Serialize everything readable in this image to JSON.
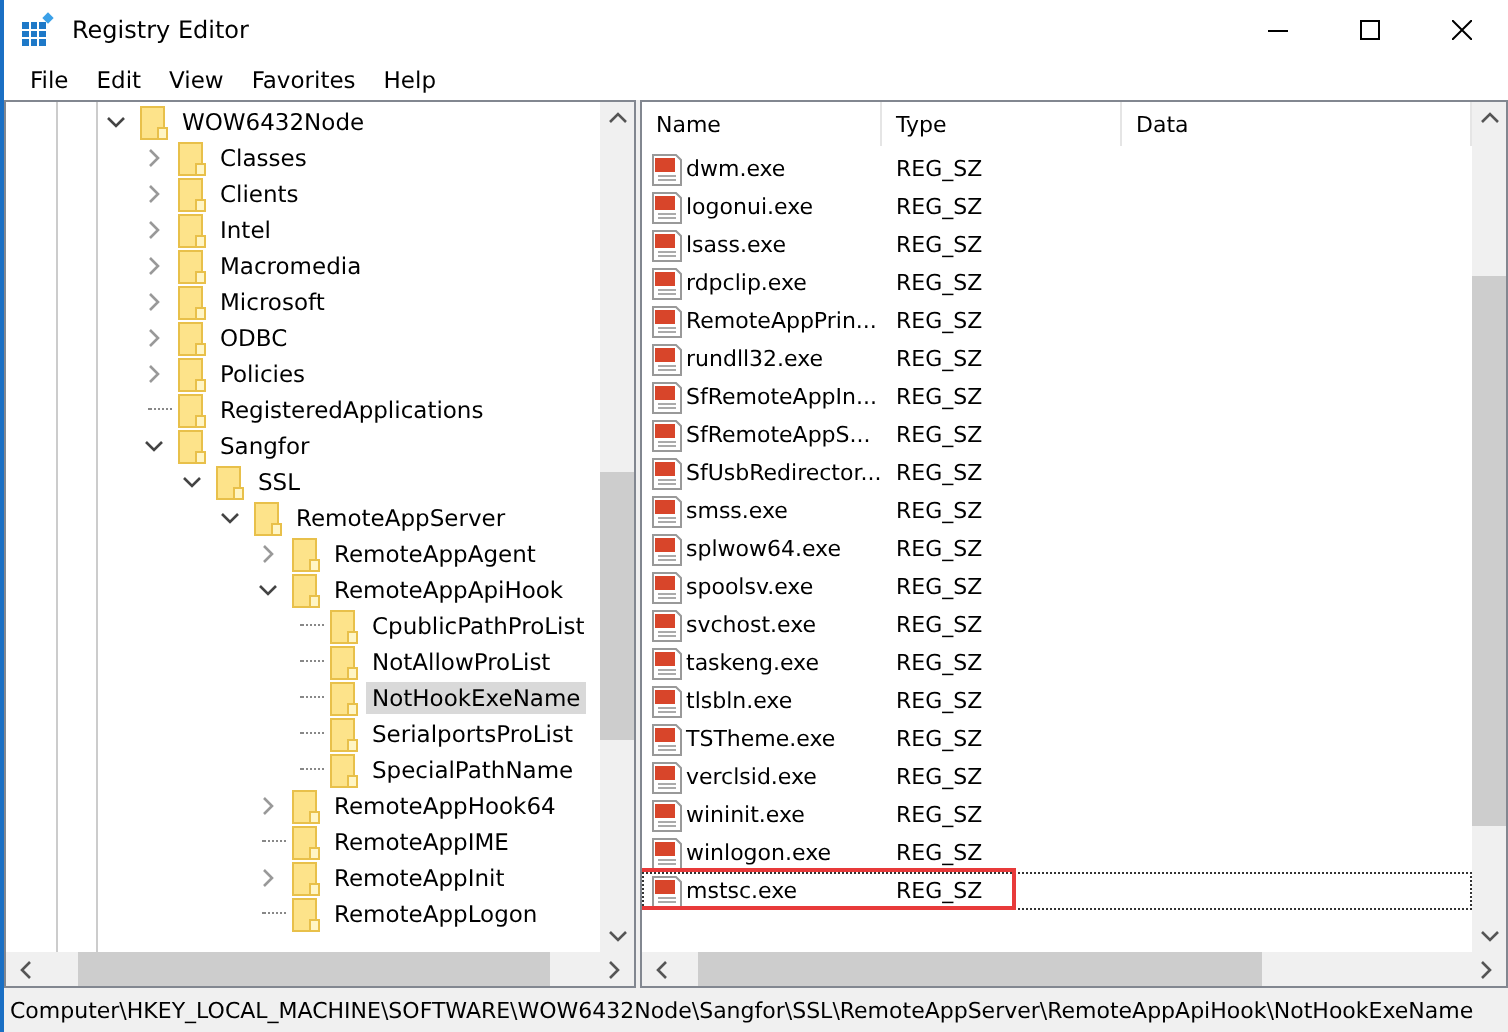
{
  "window": {
    "title": "Registry Editor"
  },
  "menu": [
    "File",
    "Edit",
    "View",
    "Favorites",
    "Help"
  ],
  "tree": [
    {
      "label": "WOW6432Node",
      "expanded": true,
      "selected": false,
      "children": [
        {
          "label": "Classes",
          "expanded": false,
          "selected": false
        },
        {
          "label": "Clients",
          "expanded": false,
          "selected": false
        },
        {
          "label": "Intel",
          "expanded": false,
          "selected": false
        },
        {
          "label": "Macromedia",
          "expanded": false,
          "selected": false
        },
        {
          "label": "Microsoft",
          "expanded": false,
          "selected": false
        },
        {
          "label": "ODBC",
          "expanded": false,
          "selected": false
        },
        {
          "label": "Policies",
          "expanded": false,
          "selected": false
        },
        {
          "label": "RegisteredApplications",
          "selected": false
        },
        {
          "label": "Sangfor",
          "expanded": true,
          "selected": false,
          "children": [
            {
              "label": "SSL",
              "expanded": true,
              "selected": false,
              "children": [
                {
                  "label": "RemoteAppServer",
                  "expanded": true,
                  "selected": false,
                  "children": [
                    {
                      "label": "RemoteAppAgent",
                      "expanded": false,
                      "selected": false
                    },
                    {
                      "label": "RemoteAppApiHook",
                      "expanded": true,
                      "selected": false,
                      "children": [
                        {
                          "label": "CpublicPathProList",
                          "selected": false
                        },
                        {
                          "label": "NotAllowProList",
                          "selected": false
                        },
                        {
                          "label": "NotHookExeName",
                          "selected": true
                        },
                        {
                          "label": "SerialportsProList",
                          "selected": false
                        },
                        {
                          "label": "SpecialPathName",
                          "selected": false
                        }
                      ]
                    },
                    {
                      "label": "RemoteAppHook64",
                      "expanded": false,
                      "selected": false
                    },
                    {
                      "label": "RemoteAppIME",
                      "selected": false
                    },
                    {
                      "label": "RemoteAppInit",
                      "expanded": false,
                      "selected": false
                    },
                    {
                      "label": "RemoteAppLogon",
                      "selected": false
                    }
                  ]
                }
              ]
            }
          ]
        }
      ]
    }
  ],
  "values": {
    "columns": [
      "Name",
      "Type",
      "Data"
    ],
    "rows": [
      {
        "name": "dwm.exe",
        "type": "REG_SZ",
        "focused": false,
        "highlighted": false
      },
      {
        "name": "logonui.exe",
        "type": "REG_SZ",
        "focused": false,
        "highlighted": false
      },
      {
        "name": "lsass.exe",
        "type": "REG_SZ",
        "focused": false,
        "highlighted": false
      },
      {
        "name": "rdpclip.exe",
        "type": "REG_SZ",
        "focused": false,
        "highlighted": false
      },
      {
        "name": "RemoteAppPrin...",
        "type": "REG_SZ",
        "focused": false,
        "highlighted": false
      },
      {
        "name": "rundll32.exe",
        "type": "REG_SZ",
        "focused": false,
        "highlighted": false
      },
      {
        "name": "SfRemoteAppIn...",
        "type": "REG_SZ",
        "focused": false,
        "highlighted": false
      },
      {
        "name": "SfRemoteAppS...",
        "type": "REG_SZ",
        "focused": false,
        "highlighted": false
      },
      {
        "name": "SfUsbRedirector...",
        "type": "REG_SZ",
        "focused": false,
        "highlighted": false
      },
      {
        "name": "smss.exe",
        "type": "REG_SZ",
        "focused": false,
        "highlighted": false
      },
      {
        "name": "splwow64.exe",
        "type": "REG_SZ",
        "focused": false,
        "highlighted": false
      },
      {
        "name": "spoolsv.exe",
        "type": "REG_SZ",
        "focused": false,
        "highlighted": false
      },
      {
        "name": "svchost.exe",
        "type": "REG_SZ",
        "focused": false,
        "highlighted": false
      },
      {
        "name": "taskeng.exe",
        "type": "REG_SZ",
        "focused": false,
        "highlighted": false
      },
      {
        "name": "tlsbln.exe",
        "type": "REG_SZ",
        "focused": false,
        "highlighted": false
      },
      {
        "name": "TSTheme.exe",
        "type": "REG_SZ",
        "focused": false,
        "highlighted": false
      },
      {
        "name": "verclsid.exe",
        "type": "REG_SZ",
        "focused": false,
        "highlighted": false
      },
      {
        "name": "wininit.exe",
        "type": "REG_SZ",
        "focused": false,
        "highlighted": false
      },
      {
        "name": "winlogon.exe",
        "type": "REG_SZ",
        "focused": false,
        "highlighted": false
      },
      {
        "name": "mstsc.exe",
        "type": "REG_SZ",
        "focused": true,
        "highlighted": true
      }
    ]
  },
  "status_bar": "Computer\\HKEY_LOCAL_MACHINE\\SOFTWARE\\WOW6432Node\\Sangfor\\SSL\\RemoteAppServer\\RemoteAppApiHook\\NotHookExeName"
}
